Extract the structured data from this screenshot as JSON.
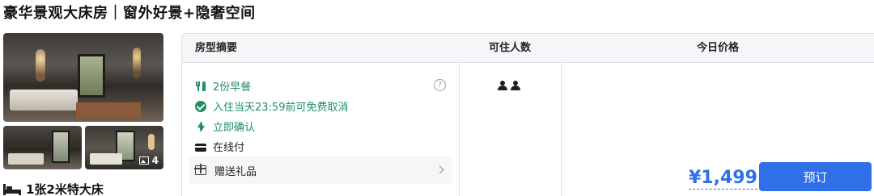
{
  "room": {
    "title": "豪华景观大床房｜窗外好景+隐奢空间",
    "photo_count": "4",
    "bed": "1张2米特大床"
  },
  "table": {
    "headers": {
      "summary": "房型摘要",
      "occupancy": "可住人数",
      "price": "今日价格"
    },
    "benefits": [
      {
        "icon": "meal-icon",
        "label": "2份早餐",
        "color": "#1f8f5f"
      },
      {
        "icon": "check-circle-icon",
        "label": "入住当天23:59前可免费取消",
        "color": "#1f8f5f"
      },
      {
        "icon": "lightning-icon",
        "label": "立即确认",
        "color": "#1f8f5f"
      },
      {
        "icon": "credit-card-icon",
        "label": "在线付",
        "color": "#1f1f1f"
      }
    ],
    "gift": "赠送礼品",
    "occupancy_count": 2,
    "price": "¥1,499",
    "book_label": "预订"
  },
  "colors": {
    "accent": "#2f6fe8",
    "benefit_green": "#1f8f5f",
    "header_bg": "#f5f6f8"
  }
}
